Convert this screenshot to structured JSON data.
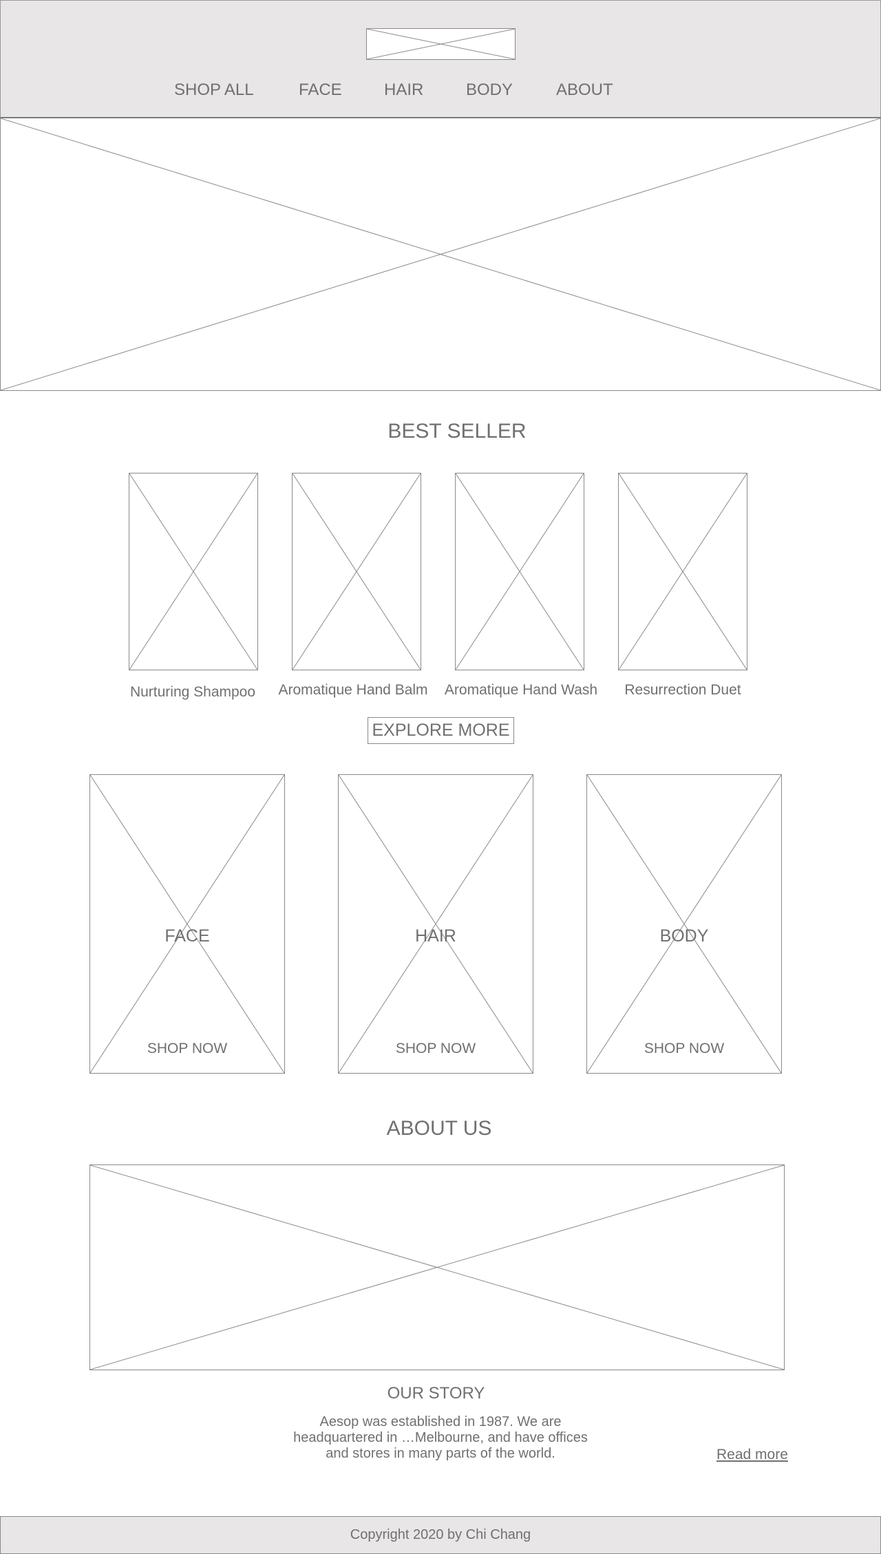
{
  "header": {
    "nav": [
      "SHOP ALL",
      "FACE",
      "HAIR",
      "BODY",
      "ABOUT"
    ]
  },
  "best_seller": {
    "title": "BEST SELLER",
    "products": [
      "Nurturing Shampoo",
      "Aromatique Hand Balm",
      "Aromatique Hand Wash",
      "Resurrection Duet"
    ],
    "explore_label": "EXPLORE MORE"
  },
  "categories": [
    {
      "label": "FACE",
      "cta": "SHOP NOW"
    },
    {
      "label": "HAIR",
      "cta": "SHOP NOW"
    },
    {
      "label": "BODY",
      "cta": "SHOP NOW"
    }
  ],
  "about": {
    "title": "ABOUT US",
    "story_title": "OUR STORY",
    "story_lines": [
      "Aesop was established in 1987. We are",
      "headquartered in …Melbourne, and have offices",
      "and stores in many parts of the world."
    ],
    "read_more": "Read more"
  },
  "footer": {
    "copyright": "Copyright  2020 by Chi Chang"
  },
  "colors": {
    "header_bg": "#e8e6e7",
    "text": "#707070",
    "placeholder_stroke": "#8a8a8a"
  }
}
